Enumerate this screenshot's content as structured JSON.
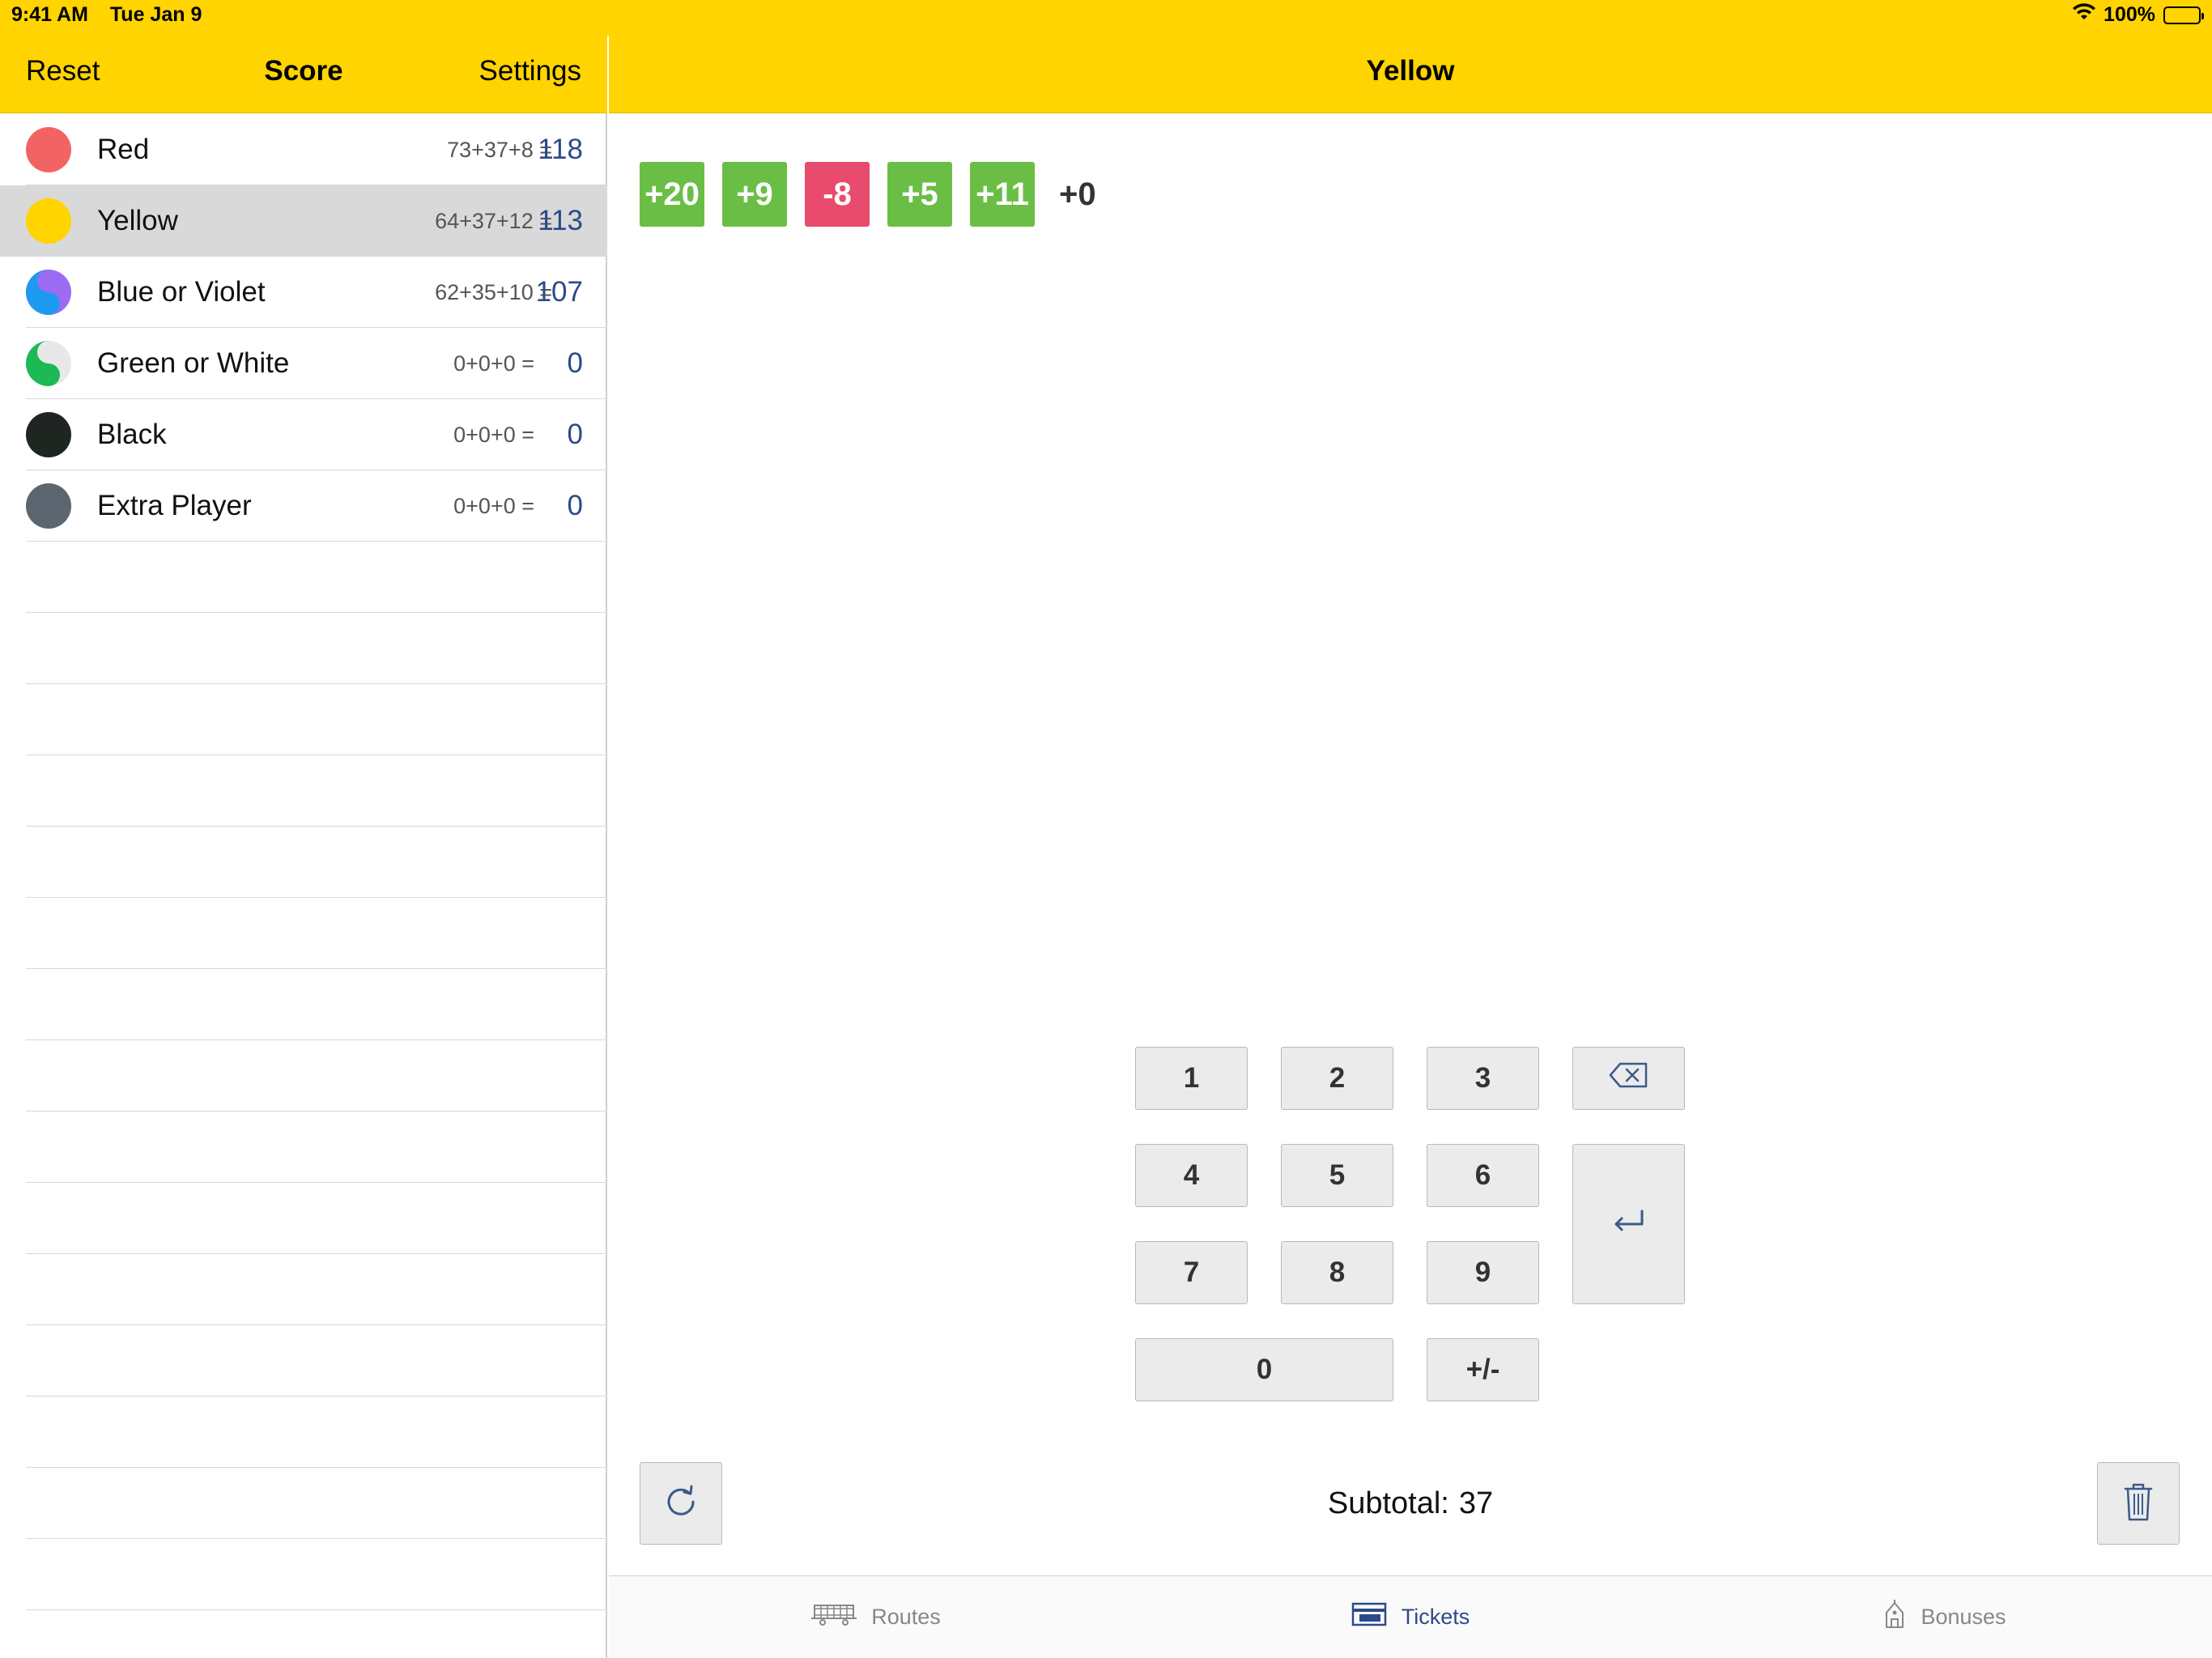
{
  "status": {
    "time": "9:41 AM",
    "date": "Tue Jan 9",
    "battery": "100%"
  },
  "left_nav": {
    "reset": "Reset",
    "title": "Score",
    "settings": "Settings"
  },
  "players": [
    {
      "name": "Red",
      "calc": "73+37+8 =",
      "total": "118",
      "color": "#F26464",
      "selected": false
    },
    {
      "name": "Yellow",
      "calc": "64+37+12 =",
      "total": "113",
      "color": "#FFD400",
      "selected": true
    },
    {
      "name": "Blue or Violet",
      "calc": "62+35+10 =",
      "total": "107",
      "colors": [
        "#1E9BF0",
        "#9B6CF2"
      ],
      "selected": false
    },
    {
      "name": "Green or White",
      "calc": "0+0+0 =",
      "total": "0",
      "colors": [
        "#1DB954",
        "#E8E8E8"
      ],
      "selected": false
    },
    {
      "name": "Black",
      "calc": "0+0+0 =",
      "total": "0",
      "color": "#1F2622",
      "selected": false
    },
    {
      "name": "Extra Player",
      "calc": "0+0+0 =",
      "total": "0",
      "color": "#5B6671",
      "selected": false
    }
  ],
  "right_nav": {
    "title": "Yellow"
  },
  "tickets": [
    {
      "label": "+20",
      "kind": "pos"
    },
    {
      "label": "+9",
      "kind": "pos"
    },
    {
      "label": "-8",
      "kind": "neg"
    },
    {
      "label": "+5",
      "kind": "pos"
    },
    {
      "label": "+11",
      "kind": "pos"
    }
  ],
  "current_entry": "+0",
  "keypad": {
    "k1": "1",
    "k2": "2",
    "k3": "3",
    "k4": "4",
    "k5": "5",
    "k6": "6",
    "k7": "7",
    "k8": "8",
    "k9": "9",
    "k0": "0",
    "sign": "+/-"
  },
  "subtotal": {
    "label": "Subtotal:",
    "value": "37"
  },
  "tabs": [
    {
      "label": "Routes",
      "icon": "train-car-icon",
      "active": false
    },
    {
      "label": "Tickets",
      "icon": "ticket-icon",
      "active": true
    },
    {
      "label": "Bonuses",
      "icon": "station-icon",
      "active": false
    }
  ],
  "colors": {
    "accent": "#FFD400",
    "positive": "#6BBE45",
    "negative": "#E94B6E",
    "link": "#2C4A8A"
  }
}
